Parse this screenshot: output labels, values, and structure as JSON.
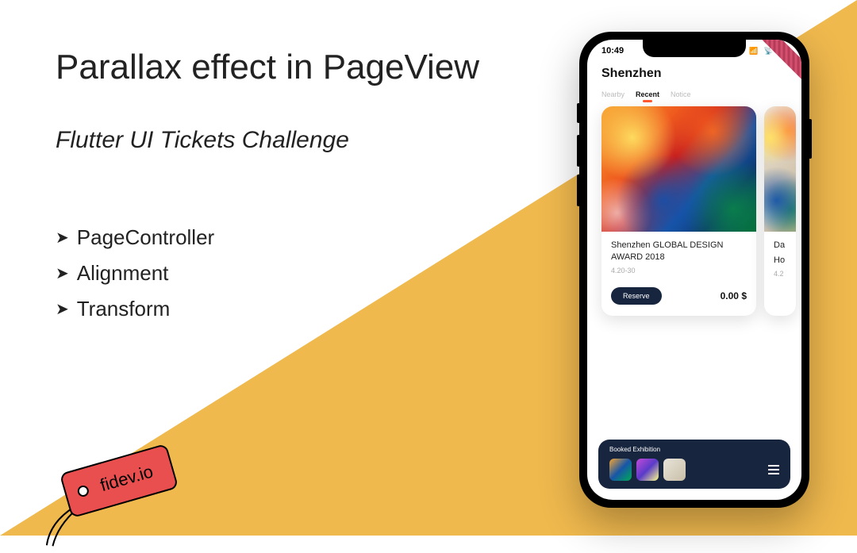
{
  "title": "Parallax effect in PageView",
  "subtitle": "Flutter UI Tickets Challenge",
  "bullets": [
    "PageController",
    "Alignment",
    "Transform"
  ],
  "tag_label": "fidev.io",
  "phone": {
    "status_time": "10:49",
    "city": "Shenzhen",
    "tabs": [
      {
        "label": "Nearby",
        "active": false
      },
      {
        "label": "Recent",
        "active": true
      },
      {
        "label": "Notice",
        "active": false
      }
    ],
    "main_card": {
      "title": "Shenzhen GLOBAL DESIGN AWARD 2018",
      "date": "4.20-30",
      "reserve_label": "Reserve",
      "price": "0.00 $"
    },
    "peek_card": {
      "title_prefix": "Da",
      "subtitle_prefix": "Ho",
      "date_prefix": "4.2"
    },
    "booked_label": "Booked Exhibition"
  },
  "colors": {
    "accent": "#f0b94e",
    "tag": "#e94f4f",
    "navy": "#17253e",
    "tab_active": "#ff5830"
  }
}
